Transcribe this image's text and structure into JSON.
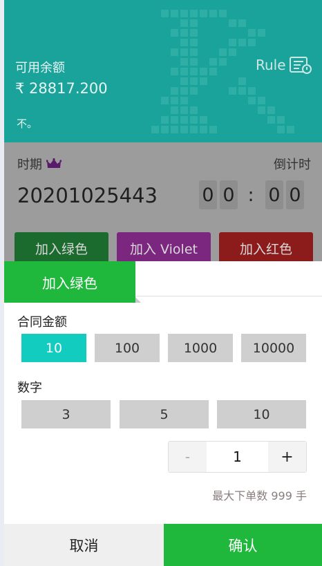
{
  "header": {
    "balance_label": "可用余额",
    "balance_value": "₹ 28817.200",
    "note": "不。",
    "rule_label": "Rule",
    "rule_icon": "rule-document-icon"
  },
  "period": {
    "label": "时期",
    "crown_icon": "crown-icon",
    "countdown_label": "倒计时",
    "number": "20201025443",
    "timer": [
      "0",
      "0",
      ":",
      "0",
      "0"
    ]
  },
  "bet_buttons": [
    {
      "label": "加入绿色",
      "color": "#1b6a2e"
    },
    {
      "label": "加入 Violet",
      "color": "#7b277f"
    },
    {
      "label": "加入红色",
      "color": "#8c1c1c"
    }
  ],
  "sheet": {
    "tab_title": "加入绿色",
    "contract_label": "合同金额",
    "contract_options": [
      "10",
      "100",
      "1000",
      "10000"
    ],
    "contract_selected": "10",
    "number_label": "数字",
    "number_options": [
      "3",
      "5",
      "10"
    ],
    "stepper": {
      "minus": "-",
      "value": "1",
      "plus": "+"
    },
    "max_note": "最大下单数 999 手",
    "cancel_label": "取消",
    "confirm_label": "确认"
  },
  "colors": {
    "teal": "#1aa39a",
    "green": "#20b83c",
    "cyan_selected": "#12ccc0"
  }
}
